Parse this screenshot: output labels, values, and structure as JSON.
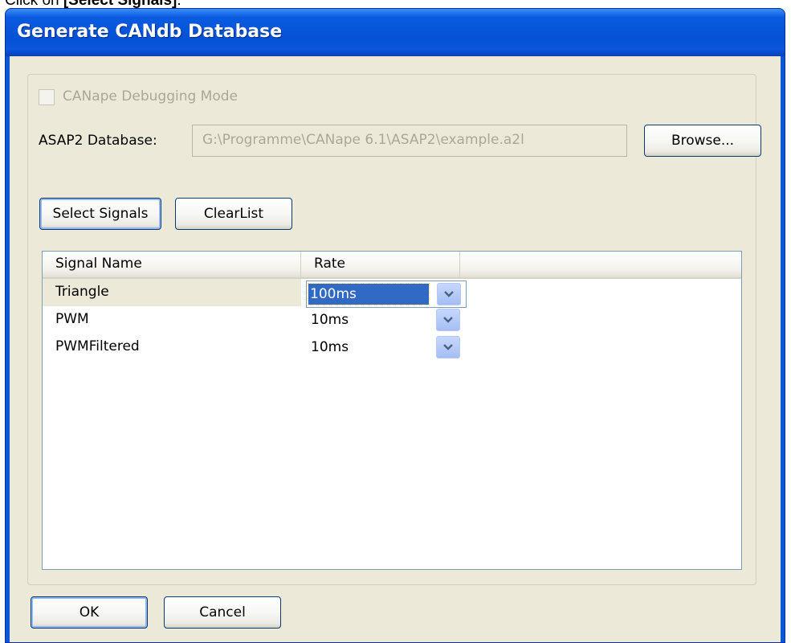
{
  "instruction": {
    "prefix": "Click on ",
    "target": "[Select Signals]",
    "suffix": "."
  },
  "window": {
    "title": "Generate CANdb Database"
  },
  "debug_mode": {
    "label": "CANape Debugging Mode",
    "checked": false,
    "enabled": false
  },
  "database": {
    "label": "ASAP2 Database:",
    "path": "G:\\Programme\\CANape 6.1\\ASAP2\\example.a2l",
    "browse_label": "Browse..."
  },
  "buttons": {
    "select_signals": "Select Signals",
    "clear_list": "ClearList",
    "ok": "OK",
    "cancel": "Cancel"
  },
  "signal_list": {
    "columns": [
      "Signal Name",
      "Rate"
    ],
    "rows": [
      {
        "name": "Triangle",
        "rate": "100ms",
        "editing": true
      },
      {
        "name": "PWM",
        "rate": "10ms",
        "editing": false
      },
      {
        "name": "PWMFiltered",
        "rate": "10ms",
        "editing": false
      }
    ]
  },
  "colors": {
    "titlebar": "#0552d6",
    "dialog_bg": "#ece9d8",
    "selection": "#316ac5"
  }
}
